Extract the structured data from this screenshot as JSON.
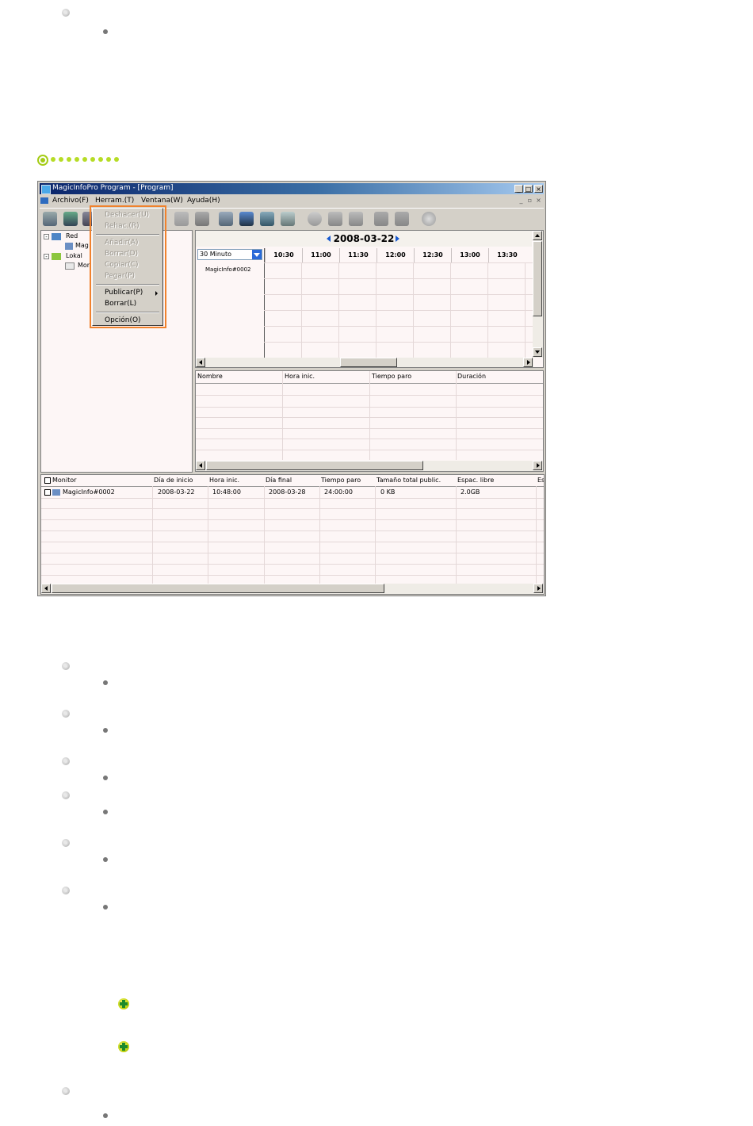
{
  "window": {
    "title": "MagicInfoPro Program - [Program]",
    "menu": [
      "Archivo(F)",
      "Herram.(T)",
      "Ventana(W)",
      "Ayuda(H)"
    ],
    "buttons": [
      "_",
      "□",
      "×"
    ],
    "mdi_buttons": [
      "_",
      "▫",
      "×"
    ]
  },
  "dropdown": {
    "items": [
      {
        "label": "Deshacer(U)",
        "enabled": false
      },
      {
        "label": "Rehac.(R)",
        "enabled": false
      },
      {
        "label": "Añadir(A)",
        "enabled": false
      },
      {
        "label": "Borrar(D)",
        "enabled": false
      },
      {
        "label": "Copiar(C)",
        "enabled": false
      },
      {
        "label": "Pegar(P)",
        "enabled": false
      },
      {
        "label": "Publicar(P)",
        "enabled": true,
        "submenu": true
      },
      {
        "label": "Borrar(L)",
        "enabled": true
      },
      {
        "label": "Opción(O)",
        "enabled": true
      }
    ],
    "highlight_color": "#f0822d"
  },
  "tree": {
    "red": "Red",
    "red_child": "Mag",
    "lokal": "Lokal",
    "lokal_child": "Mon"
  },
  "schedule": {
    "date": "2008-03-22",
    "interval": "30 Minuto",
    "times": [
      "10:30",
      "11:00",
      "11:30",
      "12:00",
      "12:30",
      "13:00",
      "13:30"
    ],
    "monitor": "MagicInfo#0002"
  },
  "content_list": {
    "columns": [
      "Nombre",
      "Hora inic.",
      "Tiempo paro",
      "Duración"
    ]
  },
  "monitor_list": {
    "columns": [
      "Monitor",
      "Día de inicio",
      "Hora inic.",
      "Día final",
      "Tiempo paro",
      "Tamaño total public.",
      "Espac. libre",
      "Es"
    ],
    "rows": [
      {
        "monitor": "MagicInfo#0002",
        "start_day": "2008-03-22",
        "start_time": "10:48:00",
        "end_day": "2008-03-28",
        "stop_time": "24:00:00",
        "total_size": "0 KB",
        "free": "2.0GB",
        "extra": ""
      }
    ]
  },
  "colors": {
    "accent_green": "#a4cc16",
    "title_blue": "#0a246a"
  }
}
